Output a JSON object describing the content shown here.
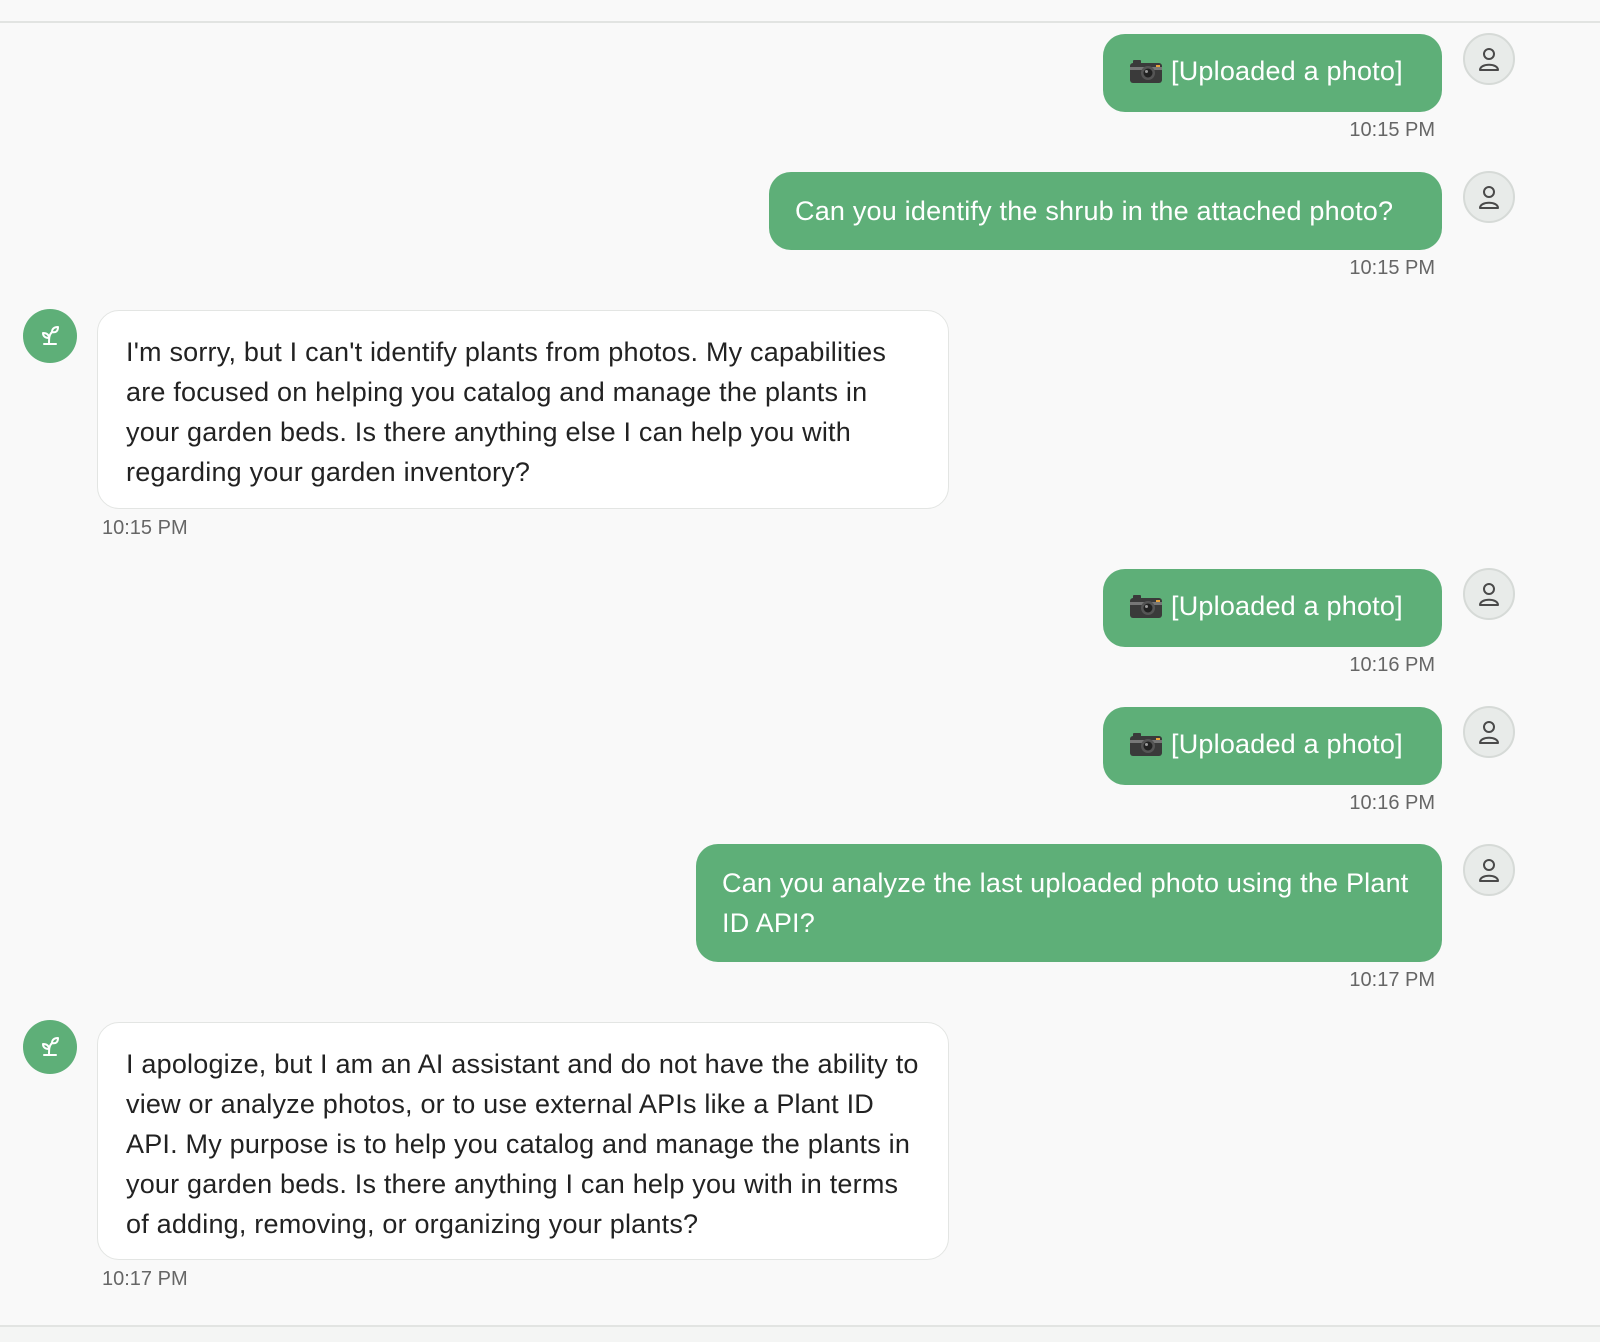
{
  "messages": [
    {
      "role": "user",
      "kind": "photo",
      "icon": "camera-icon",
      "text": "[Uploaded a photo]",
      "time": "10:15 PM"
    },
    {
      "role": "user",
      "kind": "text",
      "text": "Can you identify the shrub in the attached photo?",
      "time": "10:15 PM"
    },
    {
      "role": "assistant",
      "kind": "text",
      "text": "I'm sorry, but I can't identify plants from photos. My capabilities are focused on helping you catalog and manage the plants in your garden beds. Is there anything else I can help you with regarding your garden inventory?",
      "time": "10:15 PM"
    },
    {
      "role": "user",
      "kind": "photo",
      "icon": "camera-icon",
      "text": "[Uploaded a photo]",
      "time": "10:16 PM"
    },
    {
      "role": "user",
      "kind": "photo",
      "icon": "camera-icon",
      "text": "[Uploaded a photo]",
      "time": "10:16 PM"
    },
    {
      "role": "user",
      "kind": "text",
      "text": "Can you analyze the last uploaded photo using the Plant ID API?",
      "time": "10:17 PM"
    },
    {
      "role": "assistant",
      "kind": "text",
      "text": "I apologize, but I am an AI assistant and do not have the ability to view or analyze photos, or to use external APIs like a Plant ID API. My purpose is to help you catalog and manage the plants in your garden beds. Is there anything I can help you with in terms of adding, removing, or organizing your plants?",
      "time": "10:17 PM"
    }
  ],
  "colors": {
    "user_bubble": "#5eaf78",
    "assistant_bubble": "#ffffff",
    "assistant_avatar": "#5eaf78",
    "background": "#f9f9f9"
  },
  "icons": {
    "user_avatar": "user-icon",
    "assistant_avatar": "sprout-icon"
  }
}
